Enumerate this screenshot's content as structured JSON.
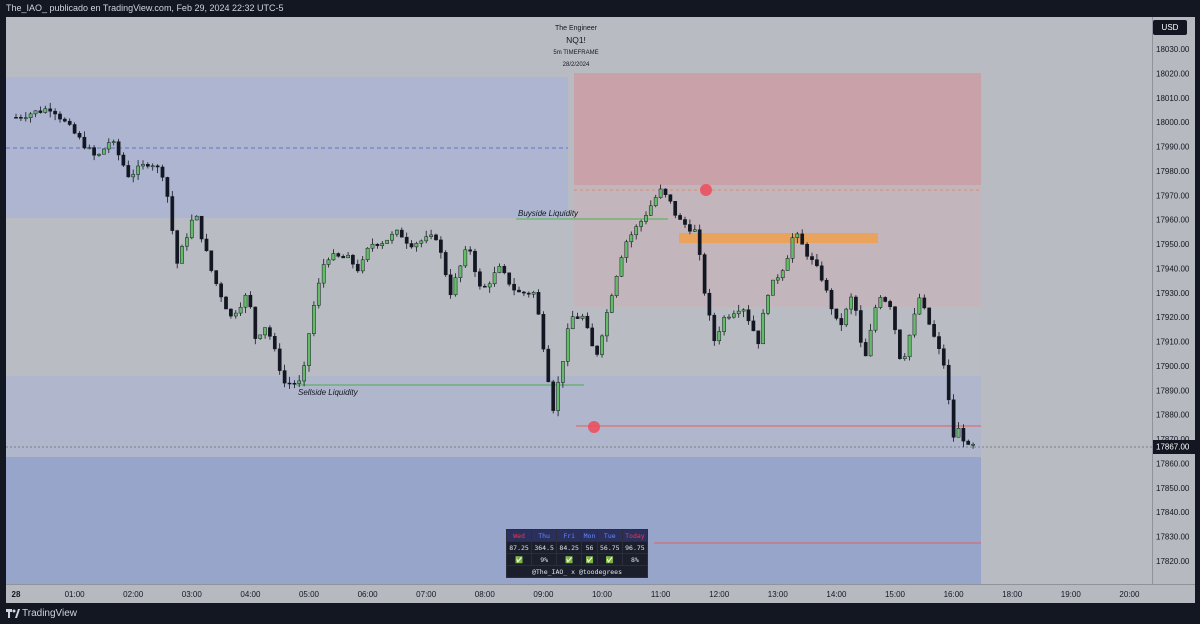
{
  "window": {
    "publish_line": "The_IAO_ publicado en TradingView.com, Feb 29, 2024 22:32 UTC-5",
    "brand": "TradingView",
    "currency": "USD"
  },
  "header": {
    "author": "The Engineer",
    "symbol": "NQ1!",
    "timeframe": "5m TIMEFRAME",
    "date": "28/2/2024"
  },
  "annotations": {
    "buyside": "Buyside Liquidity",
    "sellside": "Sellside Liquidity"
  },
  "stats_table": {
    "days": [
      "Wed",
      "Thu",
      "Fri",
      "Mon",
      "Tue",
      "Today"
    ],
    "day_colors": [
      "#f23645",
      "#5b8cff",
      "#5b8cff",
      "#5b8cff",
      "#5b8cff",
      "#f23645"
    ],
    "ranges": [
      "87.25",
      "364.5",
      "84.25",
      "56",
      "56.75",
      "96.75"
    ],
    "status": [
      "✅",
      "9%",
      "✅",
      "✅",
      "✅",
      "8%"
    ],
    "credit": "@The_IAO_ x @toodegrees"
  },
  "colors": {
    "up_candle": "#66bb6a",
    "down_candle": "#131722",
    "premium_zone": "#e68a8f",
    "upper_zone": "#aeb5d1",
    "discount_zone": "#7d93d5",
    "fvg": "#f0a04b"
  },
  "chart_data": {
    "type": "candlestick",
    "symbol": "NQ1!",
    "timeframe": "5m",
    "y_ticks": [
      "18030.00",
      "18020.00",
      "18010.00",
      "18000.00",
      "17990.00",
      "17980.00",
      "17970.00",
      "17960.00",
      "17950.00",
      "17940.00",
      "17930.00",
      "17920.00",
      "17910.00",
      "17900.00",
      "17890.00",
      "17880.00",
      "17870.00",
      "17860.00",
      "17850.00",
      "17840.00",
      "17830.00",
      "17820.00"
    ],
    "x_ticks": [
      "28",
      "01:00",
      "02:00",
      "03:00",
      "04:00",
      "05:00",
      "06:00",
      "07:00",
      "08:00",
      "09:00",
      "10:00",
      "11:00",
      "12:00",
      "13:00",
      "14:00",
      "15:00",
      "16:00",
      "18:00",
      "19:00",
      "20:00"
    ],
    "ylim": [
      17813,
      18040
    ],
    "close_price": 17867,
    "path": [
      [
        0,
        18002
      ],
      [
        2,
        18006
      ],
      [
        4.5,
        17985
      ],
      [
        5.3,
        17993
      ],
      [
        6.3,
        17978
      ],
      [
        7.5,
        17984
      ],
      [
        8.3,
        17978
      ],
      [
        9,
        17942
      ],
      [
        10,
        17963
      ],
      [
        11,
        17937
      ],
      [
        12,
        17920
      ],
      [
        13,
        17930
      ],
      [
        13.3,
        17911
      ],
      [
        14,
        17917
      ],
      [
        15,
        17893
      ],
      [
        16,
        17893
      ],
      [
        16.5,
        17920
      ],
      [
        17.3,
        17945
      ],
      [
        18.6,
        17944
      ],
      [
        19.2,
        17939
      ],
      [
        19.8,
        17950
      ],
      [
        20.5,
        17951
      ],
      [
        21.4,
        17955
      ],
      [
        22,
        17950
      ],
      [
        23.5,
        17953
      ],
      [
        24.3,
        17930
      ],
      [
        25.3,
        17950
      ],
      [
        26,
        17930
      ],
      [
        27,
        17940
      ],
      [
        28,
        17930
      ],
      [
        29,
        17930
      ],
      [
        29.6,
        17903
      ],
      [
        30,
        17882
      ],
      [
        30.5,
        17900
      ],
      [
        31,
        17920
      ],
      [
        31.7,
        17920
      ],
      [
        32.4,
        17903
      ],
      [
        33.3,
        17930
      ],
      [
        34,
        17950
      ],
      [
        35,
        17960
      ],
      [
        36,
        17972
      ],
      [
        36.5,
        17968
      ],
      [
        37,
        17960
      ],
      [
        38,
        17955
      ],
      [
        38.5,
        17930
      ],
      [
        39,
        17910
      ],
      [
        39.6,
        17920
      ],
      [
        40.6,
        17925
      ],
      [
        41.5,
        17910
      ],
      [
        42,
        17930
      ],
      [
        43,
        17942
      ],
      [
        43.5,
        17955
      ],
      [
        44.3,
        17945
      ],
      [
        45,
        17937
      ],
      [
        46,
        17915
      ],
      [
        46.8,
        17930
      ],
      [
        47.4,
        17900
      ],
      [
        48.2,
        17930
      ],
      [
        48.9,
        17925
      ],
      [
        49.5,
        17900
      ],
      [
        50.5,
        17928
      ],
      [
        51.4,
        17910
      ],
      [
        52,
        17898
      ],
      [
        52.3,
        17870
      ],
      [
        52.8,
        17875
      ],
      [
        53.1,
        17866
      ],
      [
        53.5,
        17867
      ]
    ]
  }
}
